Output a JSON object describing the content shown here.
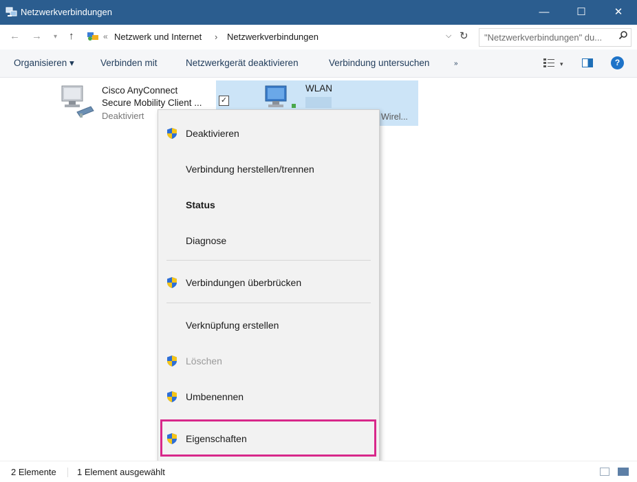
{
  "window": {
    "title": "Netzwerkverbindungen",
    "controls": {
      "minimize": "—",
      "maximize": "☐",
      "close": "✕"
    }
  },
  "address": {
    "back": "←",
    "forward": "→",
    "up": "↑",
    "crumb_sep0": "«",
    "crumbs": [
      "Netzwerk und Internet",
      "Netzwerkverbindungen"
    ],
    "crumb_sep": "›",
    "dropdown": "⌵",
    "refresh": "↻",
    "search_placeholder": "\"Netzwerkverbindungen\" du...",
    "search_icon": "⌕"
  },
  "commandbar": {
    "items": [
      "Organisieren ▾",
      "Verbinden mit",
      "Netzwerkgerät deaktivieren",
      "Verbindung untersuchen",
      "»"
    ],
    "help": "?",
    "view_dropdown": "▾"
  },
  "adapters": [
    {
      "name_line1": "Cisco AnyConnect",
      "name_line2": "Secure Mobility Client ...",
      "state": "Deaktiviert"
    },
    {
      "name": "WLAN",
      "checkbox": "✓",
      "device": "Wirel..."
    }
  ],
  "context_menu": {
    "items": [
      {
        "label": "Deaktivieren",
        "shield": true
      },
      {
        "label": "Verbindung herstellen/trennen",
        "shield": false
      },
      {
        "label": "Status",
        "shield": false,
        "bold": true
      },
      {
        "label": "Diagnose",
        "shield": false
      },
      {
        "label": "Verbindungen überbrücken",
        "shield": true
      },
      {
        "label": "Verknüpfung erstellen",
        "shield": false
      },
      {
        "label": "Löschen",
        "shield": true,
        "disabled": true
      },
      {
        "label": "Umbenennen",
        "shield": true
      },
      {
        "label": "Eigenschaften",
        "shield": true,
        "highlighted": true
      }
    ]
  },
  "statusbar": {
    "count": "2 Elemente",
    "selected": "1 Element ausgewählt"
  },
  "colors": {
    "titlebar": "#2b5d8f",
    "selection": "#cce4f7",
    "highlight_border": "#d8288a",
    "link": "#1f3b5a"
  }
}
